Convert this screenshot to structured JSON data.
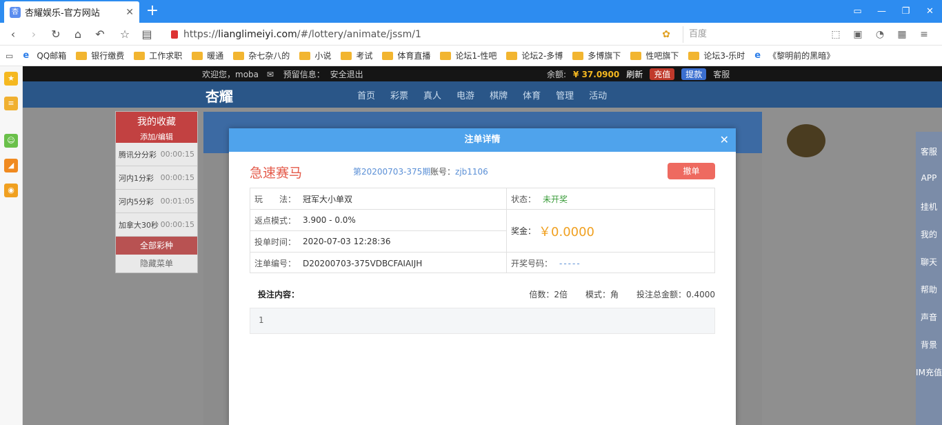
{
  "browser": {
    "tab_title": "杏耀娱乐-官方网站",
    "url_prefix": "https://",
    "url_host": "lianglimeiyi.com",
    "url_path": "/#/lottery/animate/jssm/1",
    "search_placeholder": "百度"
  },
  "bookmarks": [
    {
      "label": "QQ邮箱",
      "icon": "ie-icon"
    },
    {
      "label": "银行缴费",
      "icon": "folder-icon"
    },
    {
      "label": "工作求职",
      "icon": "folder-icon"
    },
    {
      "label": "暖通",
      "icon": "folder-icon"
    },
    {
      "label": "杂七杂八的",
      "icon": "folder-icon"
    },
    {
      "label": "小说",
      "icon": "folder-icon"
    },
    {
      "label": "考试",
      "icon": "folder-icon"
    },
    {
      "label": "体育直播",
      "icon": "folder-icon"
    },
    {
      "label": "论坛1-性吧",
      "icon": "folder-icon"
    },
    {
      "label": "论坛2-多博",
      "icon": "folder-icon"
    },
    {
      "label": "多博旗下",
      "icon": "folder-icon"
    },
    {
      "label": "性吧旗下",
      "icon": "folder-icon"
    },
    {
      "label": "论坛3-乐时",
      "icon": "folder-icon"
    },
    {
      "label": "《黎明前的黑暗》",
      "icon": "ie-icon"
    }
  ],
  "site": {
    "welcome": "欢迎您，moba",
    "warning": "预留信息：",
    "logout": "安全退出",
    "balance_label": "余额:",
    "balance": "¥ 37.0900",
    "refresh": "刷新",
    "deposit": "充值",
    "withdraw": "提款",
    "service": "客服",
    "logo": "杏耀",
    "nav": [
      "首页",
      "彩票",
      "真人",
      "电游",
      "棋牌",
      "体育",
      "管理",
      "活动"
    ]
  },
  "favorites": {
    "title": "我的收藏",
    "add": "添加/编辑",
    "items": [
      {
        "name": "腾讯分分彩",
        "time": "00:00:15"
      },
      {
        "name": "河内1分彩",
        "time": "00:00:15"
      },
      {
        "name": "河内5分彩",
        "time": "00:01:05"
      },
      {
        "name": "加拿大30秒",
        "time": "00:00:15"
      }
    ],
    "all": "全部彩种",
    "hide": "隐藏菜单"
  },
  "rightbar": [
    "客服",
    "APP",
    "挂机",
    "我的",
    "聊天",
    "帮助",
    "声音",
    "背景",
    "IM充值"
  ],
  "modal": {
    "title": "注单详情",
    "game_name": "急速赛马",
    "issue": "第20200703-375期",
    "account_label": "账号：",
    "account": "zjb1106",
    "cancel": "撤单",
    "play_label": "玩　　法：",
    "play": "冠军大小单双",
    "rebate_label": "返点模式：",
    "rebate": "3.900 - 0.0%",
    "time_label": "投单时间：",
    "time": "2020-07-03 12:28:36",
    "order_label": "注单编号：",
    "order": "D20200703-375VDBCFAIAIJH",
    "status_label": "状态：",
    "status": "未开奖",
    "bonus_label": "奖金：",
    "bonus": "￥0.0000",
    "draw_label": "开奖号码：",
    "draw": "-----",
    "content_label": "投注内容：",
    "multiple": "倍数：2倍",
    "mode": "模式：角",
    "total": "投注总金额：0.4000",
    "content": "1"
  }
}
